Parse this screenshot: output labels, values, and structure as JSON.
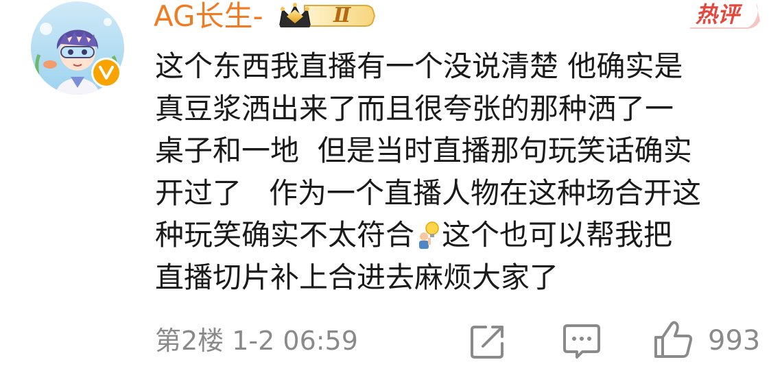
{
  "comment": {
    "username": "AG长生-",
    "level_badge": "Ⅱ",
    "hot_tag": "热评",
    "lines": [
      "这个东西我直播有一个没说清楚 他确实是",
      "真豆浆洒出来了而且很夸张的那种洒了一",
      "桌子和一地  但是当时直播那句玩笑话确实",
      "开过了   作为一个直播人物在这种场合开这",
      "种玩笑确实不太符合",
      "直播切片补上合进去麻烦大家了"
    ],
    "line5_after_emoji": "这个也可以帮我把",
    "inline_emoji": "lightbulb-person-emoji",
    "floor_and_time": "第2楼 1-2 06:59",
    "like_count": "993"
  },
  "colors": {
    "username": "#ef7b22",
    "hot_tag": "#e2483d",
    "text": "#1a1a1a",
    "meta": "#8a8a8a",
    "verified": "#f8a400"
  },
  "icons": {
    "avatar": "anime-avatar",
    "verified": "verified-v-icon",
    "level": "crown-level-badge",
    "share": "share-icon",
    "comment": "comment-icon",
    "like": "thumbs-up-icon"
  }
}
